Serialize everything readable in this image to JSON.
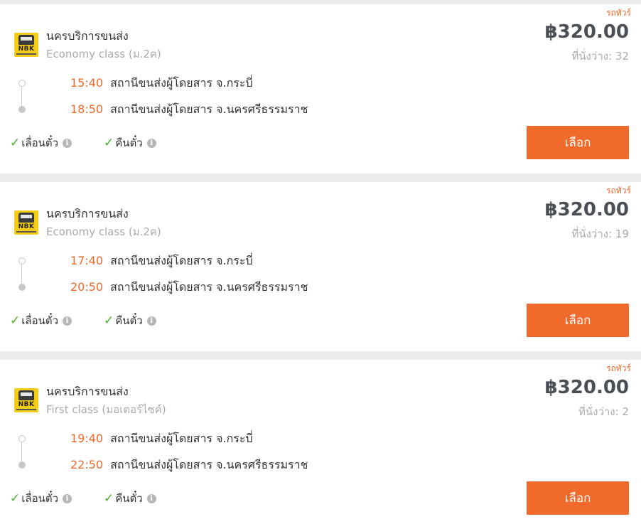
{
  "trips": [
    {
      "tag": "รถทัวร์",
      "operator": "นครบริการขนส่ง",
      "logo_text": "NBK",
      "bus_class": "Economy class (ม.2ค)",
      "price": "฿320.00",
      "seats": "ที่นั่งว่าง: 32",
      "depart_time": "15:40",
      "depart_station": "สถานีขนส่งผู้โดยสาร จ.กระบี่",
      "arrive_time": "18:50",
      "arrive_station": "สถานีขนส่งผู้โดยสาร จ.นครศรีธรรมราช",
      "feature_reschedule": "เลื่อนตั๋ว",
      "feature_refund": "คืนตั๋ว",
      "select_label": "เลือก"
    },
    {
      "tag": "รถทัวร์",
      "operator": "นครบริการขนส่ง",
      "logo_text": "NBK",
      "bus_class": "Economy class (ม.2ค)",
      "price": "฿320.00",
      "seats": "ที่นั่งว่าง: 19",
      "depart_time": "17:40",
      "depart_station": "สถานีขนส่งผู้โดยสาร จ.กระบี่",
      "arrive_time": "20:50",
      "arrive_station": "สถานีขนส่งผู้โดยสาร จ.นครศรีธรรมราช",
      "feature_reschedule": "เลื่อนตั๋ว",
      "feature_refund": "คืนตั๋ว",
      "select_label": "เลือก"
    },
    {
      "tag": "รถทัวร์",
      "operator": "นครบริการขนส่ง",
      "logo_text": "NBK",
      "bus_class": "First class (มอเตอร์ไซค์)",
      "price": "฿320.00",
      "seats": "ที่นั่งว่าง: 2",
      "depart_time": "19:40",
      "depart_station": "สถานีขนส่งผู้โดยสาร จ.กระบี่",
      "arrive_time": "22:50",
      "arrive_station": "สถานีขนส่งผู้โดยสาร จ.นครศรีธรรมราช",
      "feature_reschedule": "เลื่อนตั๋ว",
      "feature_refund": "คืนตั๋ว",
      "select_label": "เลือก"
    }
  ],
  "colors": {
    "accent": "#ef6a2b",
    "check": "#4caf2a",
    "price": "#4a4f55",
    "muted": "#aaaaaa",
    "logo": "#f2cc16"
  },
  "icons": {
    "check": "check-icon",
    "info": "info-icon",
    "logo": "bus-operator-logo"
  }
}
